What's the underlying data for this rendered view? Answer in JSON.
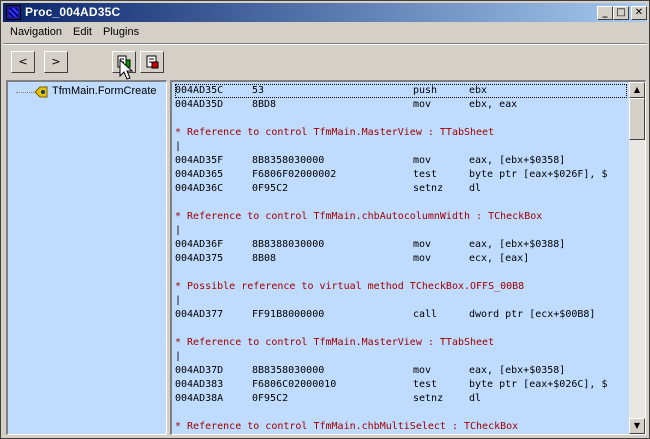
{
  "window": {
    "title": "Proc_004AD35C",
    "minimize_glyph": "_",
    "maximize_glyph": "□",
    "close_glyph": "✕"
  },
  "menu": [
    "Navigation",
    "Edit",
    "Plugins"
  ],
  "toolbar": {
    "back_glyph": "<",
    "forward_glyph": ">",
    "icons": [
      "code-nav-icon",
      "bookmark-icon"
    ]
  },
  "tree": {
    "items": [
      {
        "label": "TfmMain.FormCreate",
        "icon": "procedure-icon"
      }
    ]
  },
  "code": {
    "lines": [
      {
        "type": "asm",
        "addr": "004AD35C",
        "bytes": "53",
        "mnem": "push",
        "ops": "ebx",
        "selected": true
      },
      {
        "type": "asm",
        "addr": "004AD35D",
        "bytes": "8BD8",
        "mnem": "mov",
        "ops": "ebx, eax"
      },
      {
        "type": "blank"
      },
      {
        "type": "comment",
        "text": "* Reference to control TfmMain.MasterView : TTabSheet"
      },
      {
        "type": "bar",
        "text": "|"
      },
      {
        "type": "asm",
        "addr": "004AD35F",
        "bytes": "8B8358030000",
        "mnem": "mov",
        "ops": "eax, [ebx+$0358]"
      },
      {
        "type": "asm",
        "addr": "004AD365",
        "bytes": "F6806F02000002",
        "mnem": "test",
        "ops": "byte ptr [eax+$026F], $"
      },
      {
        "type": "asm",
        "addr": "004AD36C",
        "bytes": "0F95C2",
        "mnem": "setnz",
        "ops": "dl"
      },
      {
        "type": "blank"
      },
      {
        "type": "comment",
        "text": "* Reference to control TfmMain.chbAutocolumnWidth : TCheckBox"
      },
      {
        "type": "bar",
        "text": "|"
      },
      {
        "type": "asm",
        "addr": "004AD36F",
        "bytes": "8B8388030000",
        "mnem": "mov",
        "ops": "eax, [ebx+$0388]"
      },
      {
        "type": "asm",
        "addr": "004AD375",
        "bytes": "8B08",
        "mnem": "mov",
        "ops": "ecx, [eax]"
      },
      {
        "type": "blank"
      },
      {
        "type": "comment",
        "text": "* Possible reference to virtual method TCheckBox.OFFS_00B8"
      },
      {
        "type": "bar",
        "text": "|"
      },
      {
        "type": "asm",
        "addr": "004AD377",
        "bytes": "FF91B8000000",
        "mnem": "call",
        "ops": "dword ptr [ecx+$00B8]"
      },
      {
        "type": "blank"
      },
      {
        "type": "comment",
        "text": "* Reference to control TfmMain.MasterView : TTabSheet"
      },
      {
        "type": "bar",
        "text": "|"
      },
      {
        "type": "asm",
        "addr": "004AD37D",
        "bytes": "8B8358030000",
        "mnem": "mov",
        "ops": "eax, [ebx+$0358]"
      },
      {
        "type": "asm",
        "addr": "004AD383",
        "bytes": "F6806C02000010",
        "mnem": "test",
        "ops": "byte ptr [eax+$026C], $"
      },
      {
        "type": "asm",
        "addr": "004AD38A",
        "bytes": "0F95C2",
        "mnem": "setnz",
        "ops": "dl"
      },
      {
        "type": "blank"
      },
      {
        "type": "comment",
        "text": "* Reference to control TfmMain.chbMultiSelect : TCheckBox"
      }
    ]
  },
  "scrollbar": {
    "up_glyph": "▲",
    "down_glyph": "▼"
  },
  "colors": {
    "panel_bg": "#bfdcff",
    "comment": "#a00000",
    "titlebar_start": "#0a246a",
    "titlebar_end": "#a6caf0"
  }
}
